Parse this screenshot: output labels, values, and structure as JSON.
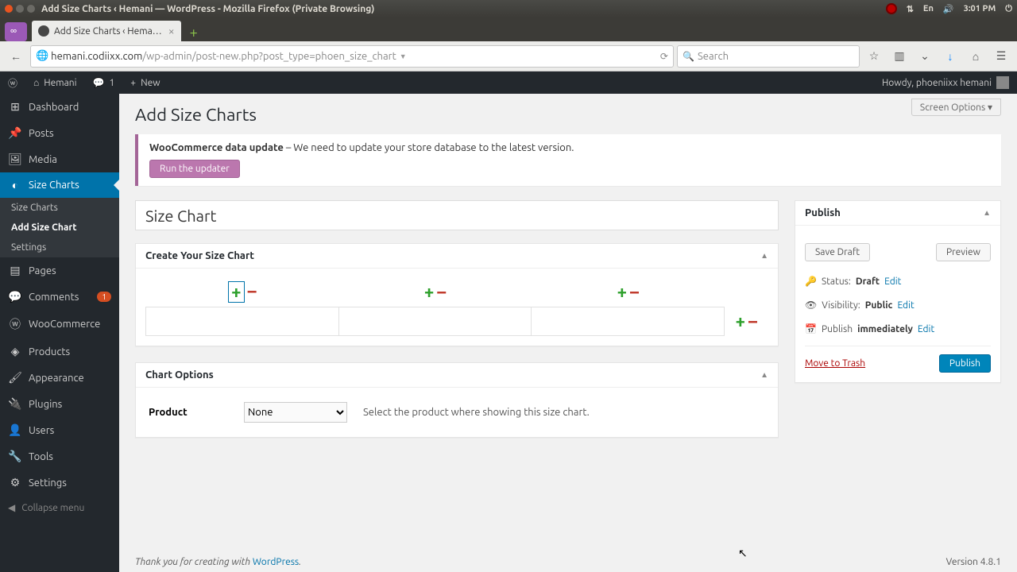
{
  "os": {
    "window_title": "Add Size Charts ‹ Hemani — WordPress - Mozilla Firefox (Private Browsing)",
    "lang": "En",
    "time": "3:01 PM"
  },
  "browser": {
    "tab_title": "Add Size Charts ‹ Hema…",
    "url_domain": "hemani.codiixx.com",
    "url_path": "/wp-admin/post-new.php?post_type=phoen_size_chart",
    "search_placeholder": "Search"
  },
  "wp": {
    "site_name": "Hemani",
    "comment_count": "1",
    "new_label": "New",
    "greeting": "Howdy, phoeniixx hemani",
    "screen_options": "Screen Options ▾",
    "page_heading": "Add Size Charts",
    "notice_bold": "WooCommerce data update",
    "notice_rest": " – We need to update your store database to the latest version.",
    "notice_button": "Run the updater",
    "title_value": "Size Chart",
    "create_box_title": "Create Your Size Chart",
    "chart_options_title": "Chart Options",
    "product_label": "Product",
    "product_selected": "None",
    "product_hint": "Select the product where showing this size chart.",
    "publish_title": "Publish",
    "save_draft": "Save Draft",
    "preview": "Preview",
    "status_label": "Status:",
    "status_value": "Draft",
    "visibility_label": "Visibility:",
    "visibility_value": "Public",
    "publish_on_label": "Publish",
    "publish_on_value": "immediately",
    "edit_label": "Edit",
    "trash_label": "Move to Trash",
    "publish_btn": "Publish",
    "footer_text": "Thank you for creating with ",
    "footer_link": "WordPress",
    "version": "Version 4.8.1",
    "collapse": "Collapse menu"
  },
  "menu": {
    "dashboard": "Dashboard",
    "posts": "Posts",
    "media": "Media",
    "size_charts": "Size Charts",
    "sub_all": "Size Charts",
    "sub_add": "Add Size Chart",
    "sub_settings": "Settings",
    "pages": "Pages",
    "comments": "Comments",
    "comments_badge": "1",
    "woocommerce": "WooCommerce",
    "products": "Products",
    "appearance": "Appearance",
    "plugins": "Plugins",
    "users": "Users",
    "tools": "Tools",
    "settings": "Settings"
  }
}
